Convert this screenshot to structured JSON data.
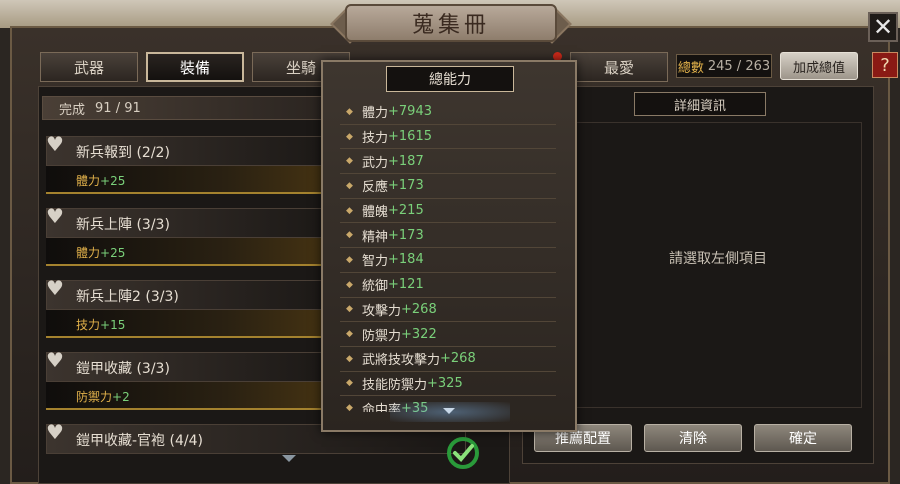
{
  "window": {
    "title": "蒐集冊"
  },
  "tabs": [
    {
      "label": "武器",
      "active": false
    },
    {
      "label": "裝備",
      "active": true
    },
    {
      "label": "坐騎",
      "active": false
    },
    {
      "label": "最愛",
      "active": false
    }
  ],
  "header": {
    "total_label": "總數",
    "total_value": "245 / 263",
    "sum_button": "加成總值",
    "help": "?",
    "close": "✕"
  },
  "left": {
    "complete_label": "完成",
    "complete_value": "91 / 91",
    "sets": [
      {
        "name": "新兵報到 (2/2)",
        "stat": "體力",
        "value": "+25"
      },
      {
        "name": "新兵上陣 (3/3)",
        "stat": "體力",
        "value": "+25"
      },
      {
        "name": "新兵上陣2 (3/3)",
        "stat": "技力",
        "value": "+15"
      },
      {
        "name": "鎧甲收藏 (3/3)",
        "stat": "防禦力",
        "value": "+2"
      },
      {
        "name": "鎧甲收藏-官袍 (4/4)",
        "stat": "",
        "value": ""
      }
    ]
  },
  "popup": {
    "title": "總能力",
    "stats": [
      {
        "name": "體力",
        "value": "+7943"
      },
      {
        "name": "技力",
        "value": "+1615"
      },
      {
        "name": "武力",
        "value": "+187"
      },
      {
        "name": "反應",
        "value": "+173"
      },
      {
        "name": "體魄",
        "value": "+215"
      },
      {
        "name": "精神",
        "value": "+173"
      },
      {
        "name": "智力",
        "value": "+184"
      },
      {
        "name": "統御",
        "value": "+121"
      },
      {
        "name": "攻擊力",
        "value": "+268"
      },
      {
        "name": "防禦力",
        "value": "+322"
      },
      {
        "name": "武將技攻擊力",
        "value": "+268"
      },
      {
        "name": "技能防禦力",
        "value": "+325"
      },
      {
        "name": "命中率",
        "value": "+35"
      }
    ]
  },
  "right": {
    "detail_title": "詳細資訊",
    "placeholder": "請選取左側項目",
    "buttons": {
      "recommend": "推薦配置",
      "clear": "清除",
      "confirm": "確定"
    }
  },
  "colors": {
    "stat_gold": "#e0b04a",
    "value_green": "#7ad07a",
    "frame": "#8a7a66"
  },
  "icons": [
    "heart-icon",
    "close-icon",
    "help-icon",
    "check-icon",
    "diamond-bullet-icon",
    "scroll-down-icon"
  ]
}
